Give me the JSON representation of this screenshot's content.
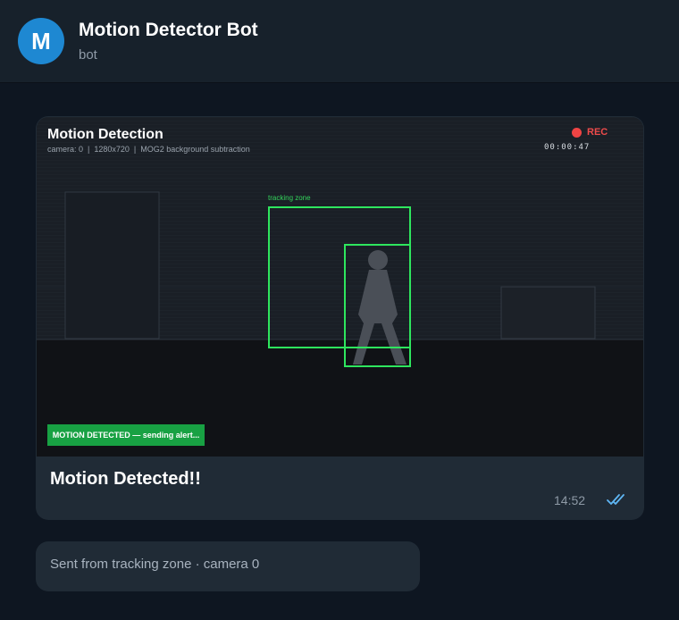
{
  "header": {
    "avatar_letter": "M",
    "title": "Motion Detector Bot",
    "subtitle": "bot"
  },
  "photo_message": {
    "camera_overlay": {
      "title": "Motion Detection",
      "meta": "camera: 0  |  1280x720  |  MOG2 background subtraction",
      "rec_label": "REC",
      "timecode": "00:00:47",
      "zone_label": "tracking zone",
      "alert_banner": "MOTION DETECTED — sending alert..."
    },
    "caption": "Motion Detected!!",
    "time": "14:52",
    "status_icon": "double-check-icon"
  },
  "text_message": {
    "text": "Sent from tracking zone · camera 0"
  },
  "colors": {
    "header_bg": "#17212b",
    "chat_bg": "#0e1621",
    "bubble_bg": "#202b36",
    "avatar": "#1e88d2",
    "detection_box": "#2ee65e",
    "rec_red": "#ef4444",
    "alert_green": "#18a143",
    "check_blue": "#5fb7f5"
  }
}
